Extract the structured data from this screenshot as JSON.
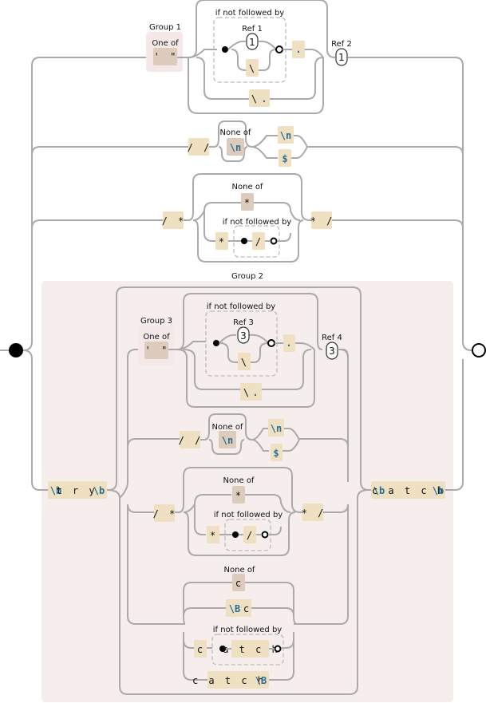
{
  "diagram": {
    "type": "regex-railroad",
    "background_group_color": "#f6eeed",
    "literal_color": "#eee0c0",
    "charclass_color": "#ddcbbb",
    "escape_color": "#2a6f97",
    "rail_color": "#aaaaaa",
    "start_marker": "filled-circle",
    "end_marker": "hollow-circle",
    "top": {
      "group1_label": "Group 1",
      "oneof_label": "One of",
      "oneof_chars": "' \"",
      "lookahead_label": "if not followed by",
      "ref1_label": "Ref 1",
      "ref1_value": "1",
      "backslash": "\\",
      "dot": ".",
      "escaped_dot_backslash": "\\",
      "escaped_dot_dot": ".",
      "ref2_label": "Ref 2",
      "ref2_value": "1"
    },
    "line_comment": {
      "start": "/ /",
      "noneof_label": "None of",
      "noneof_char": "\\n",
      "alt_newline": "\\n",
      "alt_end": "$"
    },
    "block_comment": {
      "start": "/ *",
      "noneof_label": "None of",
      "noneof_char": "*",
      "lookahead_label": "if not followed by",
      "star": "*",
      "slash": "/",
      "end": "* /"
    },
    "group2": {
      "label": "Group 2",
      "try_b1": "\\b",
      "try_word": "t r y",
      "try_b2": "\\b",
      "catch_b1": "\\b",
      "catch_word": "c a t c h",
      "catch_b2": "\\b",
      "group3_label": "Group 3",
      "oneof_label": "One of",
      "oneof_chars": "' \"",
      "lookahead_label": "if not followed by",
      "ref3_label": "Ref 3",
      "ref3_value": "3",
      "backslash": "\\",
      "dot": ".",
      "escaped_dot_backslash": "\\",
      "escaped_dot_dot": ".",
      "ref4_label": "Ref 4",
      "ref4_value": "3",
      "line_comment": {
        "start": "/ /",
        "noneof_label": "None of",
        "noneof_char": "\\n",
        "alt_newline": "\\n",
        "alt_end": "$"
      },
      "block_comment": {
        "start": "/ *",
        "noneof_label": "None of",
        "noneof_char": "*",
        "lookahead_label": "if not followed by",
        "star": "*",
        "slash": "/",
        "end": "* /"
      },
      "c_branch": {
        "noneof_label": "None of",
        "noneof_char": "c",
        "nonboundary": "\\B",
        "c_after_B": "c",
        "c_single": "c",
        "lookahead_label": "if not followed by",
        "atch": "a t c h",
        "catch_word": "c a t c h",
        "catch_B": "\\B"
      }
    }
  }
}
